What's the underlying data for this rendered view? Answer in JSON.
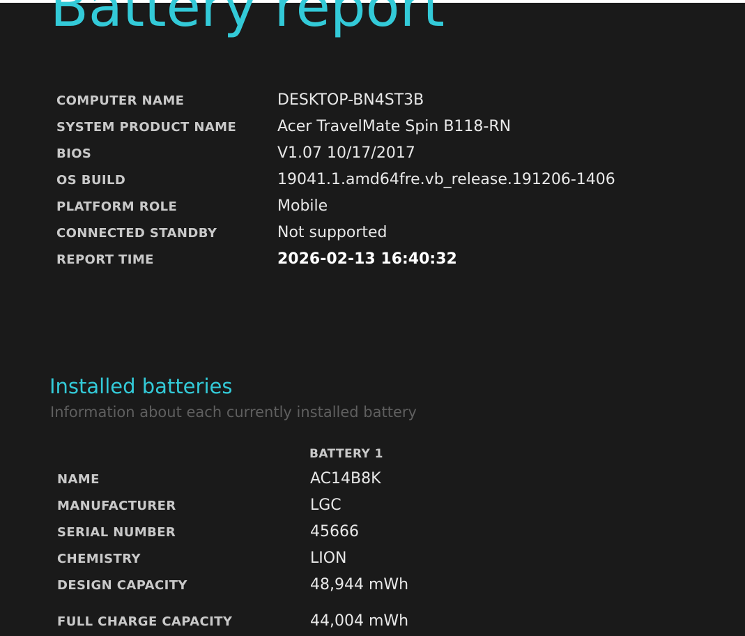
{
  "report": {
    "title": "Battery report",
    "info": [
      {
        "label": "COMPUTER NAME",
        "value": "DESKTOP-BN4ST3B"
      },
      {
        "label": "SYSTEM PRODUCT NAME",
        "value": "Acer TravelMate Spin B118-RN"
      },
      {
        "label": "BIOS",
        "value": "V1.07 10/17/2017"
      },
      {
        "label": "OS BUILD",
        "value": "19041.1.amd64fre.vb_release.191206-1406"
      },
      {
        "label": "PLATFORM ROLE",
        "value": "Mobile"
      },
      {
        "label": "CONNECTED STANDBY",
        "value": "Not supported"
      },
      {
        "label": "REPORT TIME",
        "value": "2026-02-13  16:40:32"
      }
    ]
  },
  "installed_batteries": {
    "title": "Installed batteries",
    "subtitle": "Information about each currently installed battery",
    "column_header": "BATTERY 1",
    "rows": [
      {
        "label": "NAME",
        "value": "AC14B8K"
      },
      {
        "label": "MANUFACTURER",
        "value": "LGC"
      },
      {
        "label": "SERIAL NUMBER",
        "value": "45666"
      },
      {
        "label": "CHEMISTRY",
        "value": "LION"
      },
      {
        "label": "DESIGN CAPACITY",
        "value": "48,944 mWh"
      },
      {
        "label": "FULL CHARGE CAPACITY",
        "value": "44,004 mWh"
      }
    ]
  },
  "colors": {
    "background": "#1a1a1a",
    "accent": "#33cad8",
    "label": "#c9c9c9",
    "value": "#e8e8e8",
    "subtitle": "#5f5f5f"
  }
}
